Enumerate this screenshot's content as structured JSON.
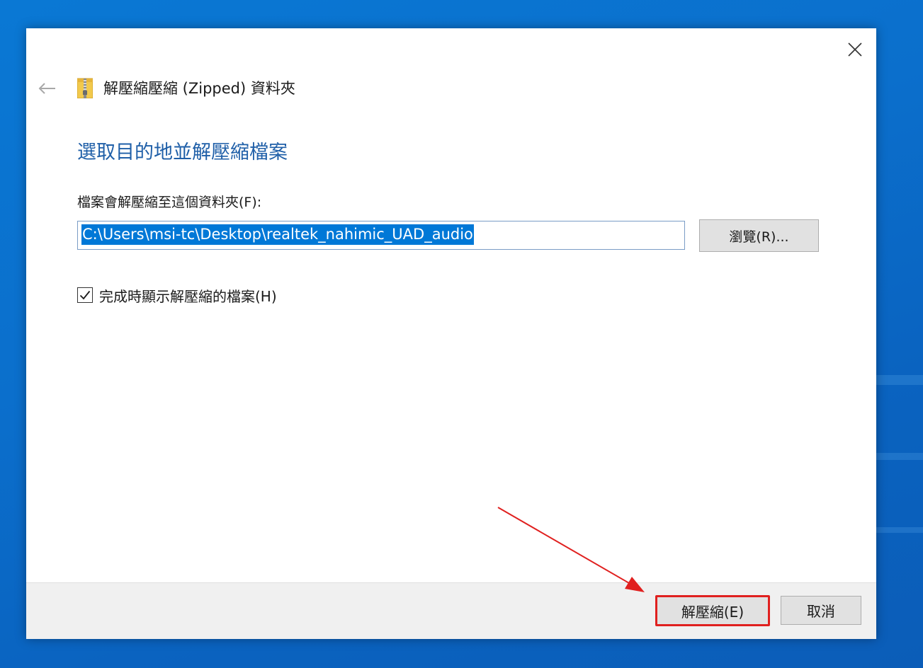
{
  "dialog": {
    "window_title": "解壓縮壓縮 (Zipped) 資料夾",
    "main_instruction": "選取目的地並解壓縮檔案",
    "destination_label": "檔案會解壓縮至這個資料夾(F):",
    "destination_path": "C:\\Users\\msi-tc\\Desktop\\realtek_nahimic_UAD_audio",
    "browse_label": "瀏覽(R)...",
    "show_files_checkbox": {
      "label": "完成時顯示解壓縮的檔案(H)",
      "checked": true
    },
    "extract_label": "解壓縮(E)",
    "cancel_label": "取消"
  },
  "icons": {
    "back": "back-arrow-icon",
    "close": "close-icon",
    "folder": "zip-folder-icon",
    "check": "checkmark-icon"
  },
  "colors": {
    "instruction_text": "#1f5fa8",
    "selection": "#0078d7",
    "annotation": "#e0201f",
    "desktop": "#0a6ecf"
  }
}
